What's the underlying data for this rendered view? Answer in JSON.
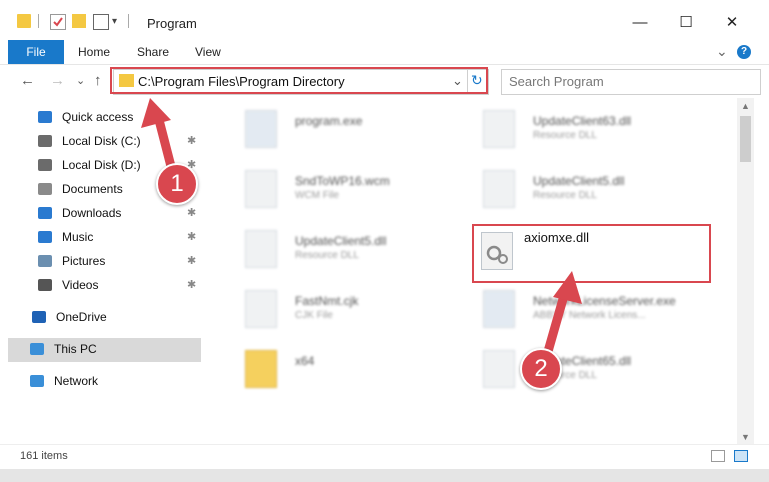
{
  "window": {
    "title": "Program",
    "minimize": "—",
    "maximize": "☐",
    "close": "✕"
  },
  "ribbon": {
    "tabs": [
      "File",
      "Home",
      "Share",
      "View"
    ],
    "expand": "⌄",
    "help": "?"
  },
  "address": {
    "path": "C:\\Program Files\\Program Directory",
    "dropdown": "⌄",
    "refresh": "↻"
  },
  "nav": {
    "back": "←",
    "forward": "→",
    "recent": "⌄",
    "up": "↑"
  },
  "search": {
    "placeholder": "Search Program"
  },
  "sidebar": {
    "items": [
      {
        "label": "Quick access",
        "icon": "star-icon",
        "pinned": false
      },
      {
        "label": "Local Disk (C:)",
        "icon": "drive-icon",
        "pinned": true
      },
      {
        "label": "Local Disk (D:)",
        "icon": "drive-icon",
        "pinned": true
      },
      {
        "label": "Documents",
        "icon": "document-icon",
        "pinned": true
      },
      {
        "label": "Downloads",
        "icon": "download-icon",
        "pinned": true
      },
      {
        "label": "Music",
        "icon": "music-icon",
        "pinned": true
      },
      {
        "label": "Pictures",
        "icon": "pictures-icon",
        "pinned": true
      },
      {
        "label": "Videos",
        "icon": "video-icon",
        "pinned": true
      },
      {
        "label": "OneDrive",
        "icon": "cloud-icon",
        "pinned": false
      },
      {
        "label": "This PC",
        "icon": "computer-icon",
        "pinned": false
      },
      {
        "label": "Network",
        "icon": "network-icon",
        "pinned": false
      }
    ],
    "pin_glyph": "📌"
  },
  "files": [
    {
      "name": "program.exe",
      "desc": ""
    },
    {
      "name": "UpdateClient63.dll",
      "desc": "Resource DLL"
    },
    {
      "name": "SndToWP16.wcm",
      "desc": "WCM File"
    },
    {
      "name": "UpdateClient5.dll",
      "desc": "Resource DLL"
    },
    {
      "name": "UpdateClient5.dll",
      "desc": "Resource DLL"
    },
    {
      "name": "FastNmt.cjk",
      "desc": "CJK File"
    },
    {
      "name": "NetworkLicenseServer.exe",
      "desc": "ABBYY Network Licens..."
    },
    {
      "name": "x64",
      "desc": ""
    },
    {
      "name": "UpdateClient65.dll",
      "desc": "Resource DLL"
    }
  ],
  "highlighted_file": {
    "name": "axiomxe.dll"
  },
  "status": {
    "item_count": "161 items"
  },
  "callouts": [
    "1",
    "2"
  ],
  "colors": {
    "accent": "#1979ca",
    "highlight": "#d9474f"
  }
}
